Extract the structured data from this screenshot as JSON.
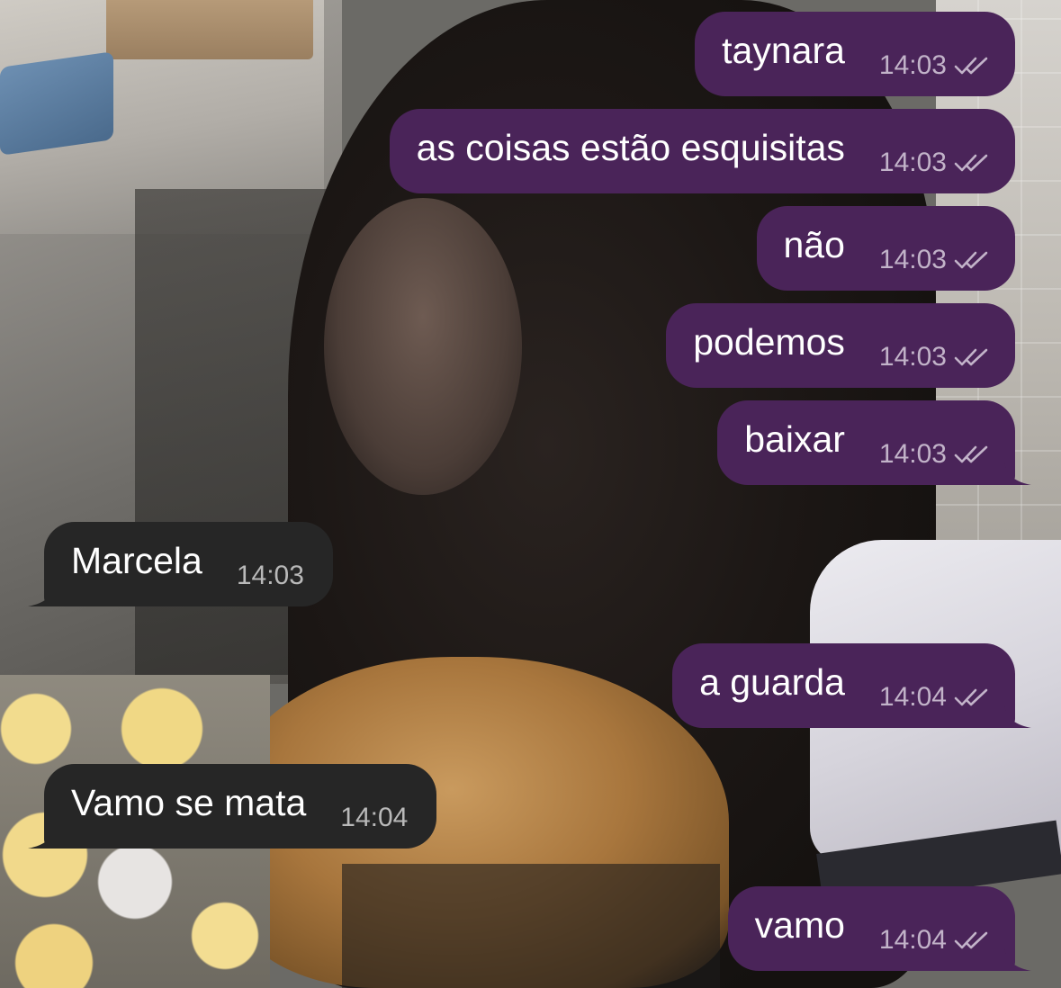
{
  "chat": {
    "colors": {
      "outgoing_bubble": "#4a2459",
      "incoming_bubble": "#262626",
      "outgoing_meta": "#c2b3c9",
      "incoming_meta": "#b9b9b9",
      "text": "#ffffff"
    },
    "status_icon": "double-check-icon",
    "messages": [
      {
        "direction": "outgoing",
        "text": "taynara",
        "time": "14:03",
        "status": "read"
      },
      {
        "direction": "outgoing",
        "text": "as coisas estão esquisitas",
        "time": "14:03",
        "status": "read"
      },
      {
        "direction": "outgoing",
        "text": "não",
        "time": "14:03",
        "status": "read"
      },
      {
        "direction": "outgoing",
        "text": "podemos",
        "time": "14:03",
        "status": "read"
      },
      {
        "direction": "outgoing",
        "text": "baixar",
        "time": "14:03",
        "status": "read"
      },
      {
        "direction": "incoming",
        "text": "Marcela",
        "time": "14:03"
      },
      {
        "direction": "outgoing",
        "text": "a guarda",
        "time": "14:04",
        "status": "read"
      },
      {
        "direction": "incoming",
        "text": "Vamo se mata",
        "time": "14:04"
      },
      {
        "direction": "outgoing",
        "text": "vamo",
        "time": "14:04",
        "status": "read"
      }
    ]
  }
}
